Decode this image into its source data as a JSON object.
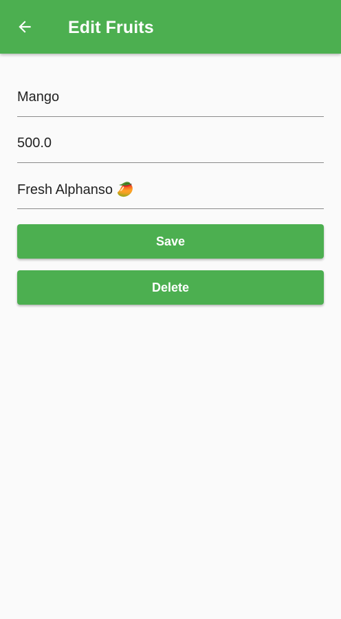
{
  "app_bar": {
    "title": "Edit Fruits",
    "back_icon": "arrow-back-icon",
    "color": "#4caf50"
  },
  "form": {
    "name_value": "Mango",
    "price_value": "500.0",
    "description_value": "Fresh Alphanso 🥭"
  },
  "actions": {
    "save_label": "Save",
    "delete_label": "Delete"
  }
}
